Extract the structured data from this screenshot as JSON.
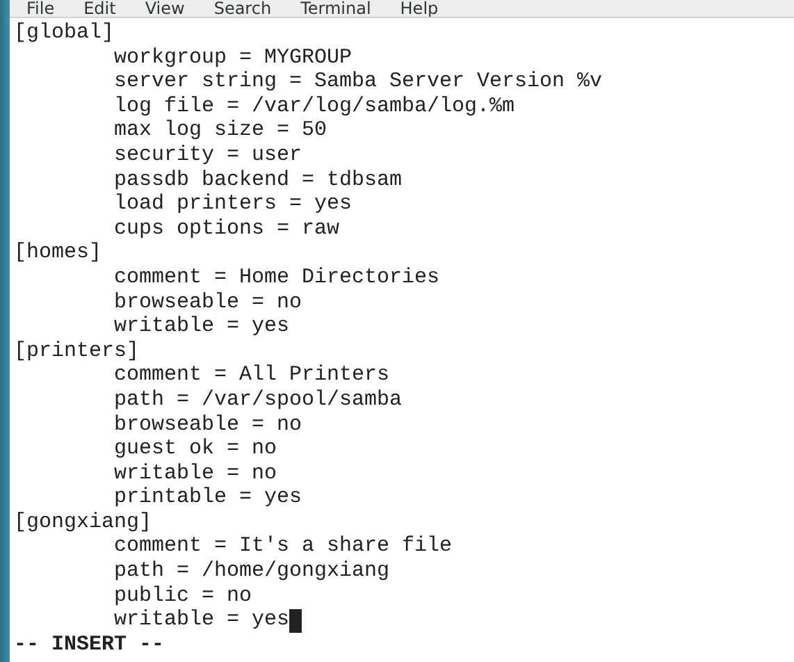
{
  "menu": [
    "File",
    "Edit",
    "View",
    "Search",
    "Terminal",
    "Help"
  ],
  "lines": [
    {
      "kind": "section",
      "text": "[global]"
    },
    {
      "kind": "setting",
      "text": "workgroup = MYGROUP"
    },
    {
      "kind": "setting",
      "text": "server string = Samba Server Version %v"
    },
    {
      "kind": "setting",
      "text": "log file = /var/log/samba/log.%m"
    },
    {
      "kind": "setting",
      "text": "max log size = 50"
    },
    {
      "kind": "setting",
      "text": "security = user"
    },
    {
      "kind": "setting",
      "text": "passdb backend = tdbsam"
    },
    {
      "kind": "setting",
      "text": "load printers = yes"
    },
    {
      "kind": "setting",
      "text": "cups options = raw"
    },
    {
      "kind": "section",
      "text": "[homes]"
    },
    {
      "kind": "setting",
      "text": "comment = Home Directories"
    },
    {
      "kind": "setting",
      "text": "browseable = no"
    },
    {
      "kind": "setting",
      "text": "writable = yes"
    },
    {
      "kind": "section",
      "text": "[printers]"
    },
    {
      "kind": "setting",
      "text": "comment = All Printers"
    },
    {
      "kind": "setting",
      "text": "path = /var/spool/samba"
    },
    {
      "kind": "setting",
      "text": "browseable = no"
    },
    {
      "kind": "setting",
      "text": "guest ok = no"
    },
    {
      "kind": "setting",
      "text": "writable = no"
    },
    {
      "kind": "setting",
      "text": "printable = yes"
    },
    {
      "kind": "section",
      "text": "[gongxiang]"
    },
    {
      "kind": "setting",
      "text": "comment = It's a share file"
    },
    {
      "kind": "setting",
      "text": "path = /home/gongxiang"
    },
    {
      "kind": "setting",
      "text": "public = no"
    },
    {
      "kind": "setting",
      "text": "writable = yes",
      "cursor": true
    }
  ],
  "status": "-- INSERT --"
}
